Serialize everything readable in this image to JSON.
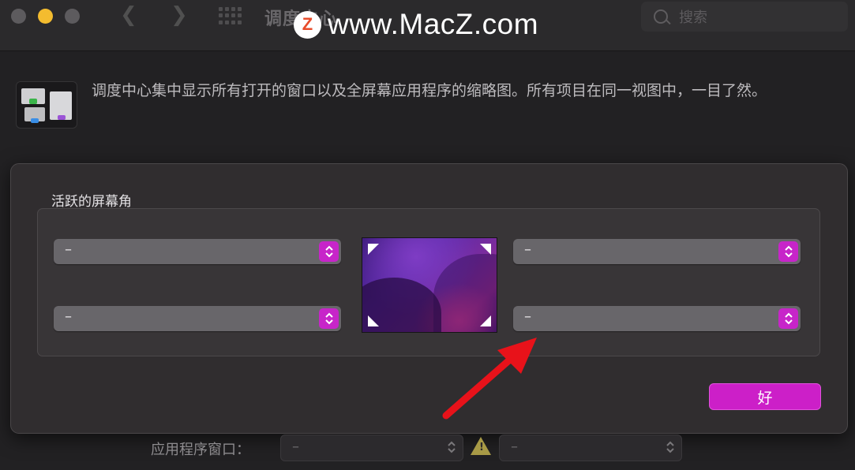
{
  "window": {
    "title": "调度中心",
    "search_placeholder": "搜索"
  },
  "watermark": {
    "logo_letter": "Z",
    "text": "www.MacZ.com"
  },
  "description": "调度中心集中显示所有打开的窗口以及全屏幕应用程序的缩略图。所有项目在同一视图中，一目了然。",
  "sheet": {
    "title": "活跃的屏幕角",
    "corners": {
      "top_left": "–",
      "top_right": "–",
      "bottom_left": "–",
      "bottom_right": "–"
    },
    "ok_label": "好"
  },
  "bottom_row": {
    "label": "应用程序窗口：",
    "left_value": "–",
    "right_value": "–"
  },
  "colors": {
    "accent": "#c725c9",
    "arrow": "#e8121a",
    "background": "#222123"
  },
  "icons": [
    "back-chevron-icon",
    "forward-chevron-icon",
    "show-all-grid-icon",
    "search-icon",
    "updown-chevron-icon",
    "warning-icon",
    "red-arrow-annotation"
  ]
}
